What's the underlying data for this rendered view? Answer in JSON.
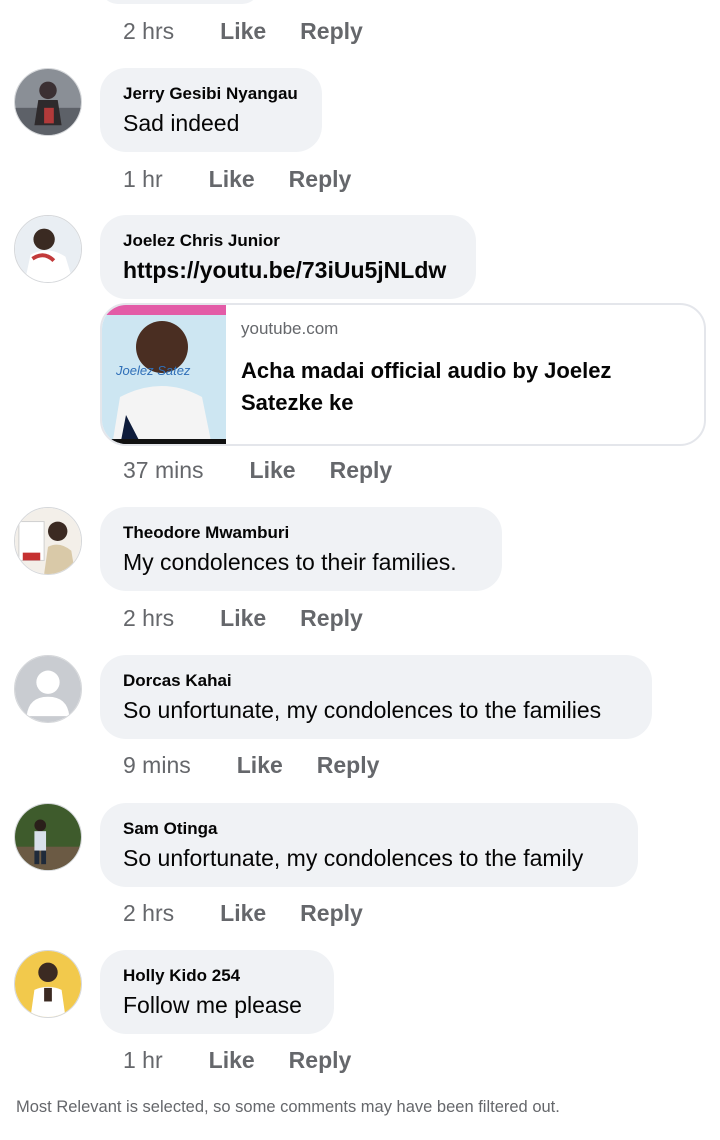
{
  "top_actions": {
    "time": "2 hrs",
    "like": "Like",
    "reply": "Reply"
  },
  "comments": [
    {
      "author": "Jerry Gesibi Nyangau",
      "text": "Sad indeed",
      "time": "1 hr",
      "like": "Like",
      "reply": "Reply"
    },
    {
      "author": "Joelez Chris Junior",
      "text": "https://youtu.be/73iUu5jNLdw",
      "time": "37 mins",
      "like": "Like",
      "reply": "Reply",
      "link_preview": {
        "domain": "youtube.com",
        "title": "Acha madai official audio by Joelez Satezke ke",
        "thumb_text": "Joelez Satez"
      }
    },
    {
      "author": "Theodore Mwamburi",
      "text": "My condolences to their families.",
      "time": "2 hrs",
      "like": "Like",
      "reply": "Reply"
    },
    {
      "author": "Dorcas Kahai",
      "text": "So unfortunate, my condolences to the families",
      "time": "9 mins",
      "like": "Like",
      "reply": "Reply"
    },
    {
      "author": "Sam Otinga",
      "text": "So unfortunate, my condolences to the family",
      "time": "2 hrs",
      "like": "Like",
      "reply": "Reply"
    },
    {
      "author": "Holly Kido 254",
      "text": "Follow me please",
      "time": "1 hr",
      "like": "Like",
      "reply": "Reply"
    }
  ],
  "footer_note": "Most Relevant is selected, so some comments may have been filtered out.",
  "colors": {
    "bubble": "#f0f2f5",
    "secondary_text": "#65676b",
    "primary_text": "#050505"
  }
}
